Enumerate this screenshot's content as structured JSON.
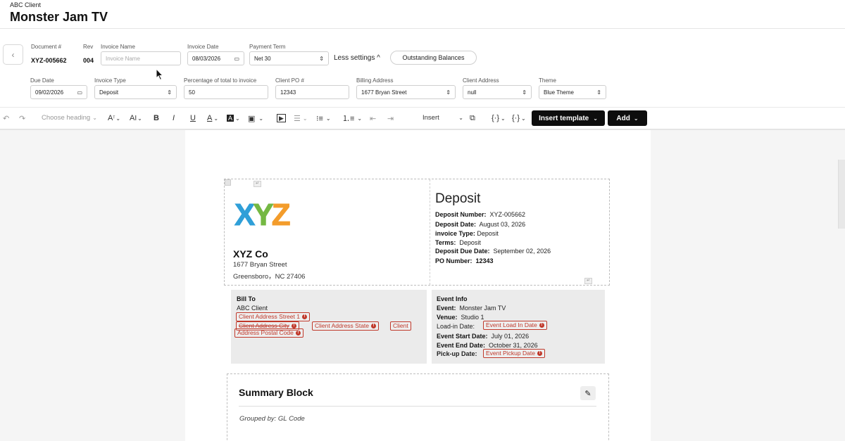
{
  "header": {
    "client": "ABC Client",
    "title": "Monster Jam TV"
  },
  "back": {
    "icon": "chevron-left-icon",
    "glyph": "‹"
  },
  "fields_row1": {
    "document_label": "Document #",
    "document_value": "XYZ-005662",
    "rev_label": "Rev",
    "rev_value": "004",
    "invoice_name_label": "Invoice Name",
    "invoice_name_placeholder": "Invoice Name",
    "invoice_date_label": "Invoice Date",
    "invoice_date_value": "08/03/2026",
    "payment_term_label": "Payment Term",
    "payment_term_value": "Net 30",
    "less_settings": "Less settings ^",
    "outstanding_balances": "Outstanding Balances"
  },
  "fields_row2": {
    "due_date_label": "Due Date",
    "due_date_value": "09/02/2026",
    "invoice_type_label": "Invoice Type",
    "invoice_type_value": "Deposit",
    "percentage_label": "Percentage of total to invoice",
    "percentage_value": "50",
    "client_po_label": "Client PO #",
    "client_po_value": "12343",
    "billing_address_label": "Billing Address",
    "billing_address_value": "1677 Bryan Street",
    "client_address_label": "Client Address",
    "client_address_value": "null",
    "theme_label": "Theme",
    "theme_value": "Blue Theme"
  },
  "toolbar": {
    "undo": "↶",
    "redo": "↷",
    "heading": "Choose heading",
    "font_size": "A",
    "font_family": "A",
    "bold": "B",
    "italic": "I",
    "underline": "U",
    "font_color": "A",
    "highlight": "A",
    "image": "▣",
    "media": "▶",
    "insert": "Insert",
    "insert_template": "Insert template",
    "add": "Add"
  },
  "document": {
    "logo_letters": [
      "X",
      "Y",
      "Z"
    ],
    "logo_colors": [
      "#2f9fd8",
      "#74b843",
      "#f39c2b"
    ],
    "company_name": "XYZ Co",
    "company_street": "1677 Bryan Street",
    "company_city": "Greensboro，NC  27406",
    "deposit_title": "Deposit",
    "deposit_number_label": "Deposit Number:",
    "deposit_number": "XYZ-005662",
    "deposit_date_label": "Deposit Date:",
    "deposit_date": "August 03, 2026",
    "invoice_type_label": "invoice Type:",
    "invoice_type": "Deposit",
    "terms_label": "Terms:",
    "terms": "Deposit",
    "due_date_label": "Deposit Due Date:",
    "due_date": "September 02, 2026",
    "po_label": "PO Number:",
    "po": "12343",
    "bill_to_label": "Bill To",
    "bill_to_client": "ABC Client",
    "ph_street": "Client Address Street 1",
    "ph_city": "Client Address City",
    "ph_state": "Client Address State",
    "ph_client": "Client",
    "ph_postal": "Address Postal Code",
    "event_info_label": "Event Info",
    "event_label": "Event:",
    "event": "Monster Jam TV",
    "venue_label": "Venue:",
    "venue": "Studio 1",
    "loadin_label": "Load-in Date:",
    "ph_loadin": "Event Load In Date",
    "start_label": "Event Start Date:",
    "start": "July 01, 2026",
    "end_label": "Event End Date:",
    "end": "October 31, 2026",
    "pickup_label": "Pick-up Date:",
    "ph_pickup": "Event Pickup Date",
    "summary_title": "Summary Block",
    "grouped_by": "Grouped by: GL Code"
  }
}
